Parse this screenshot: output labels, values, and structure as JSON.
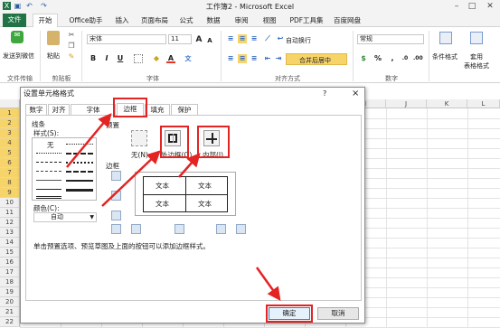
{
  "window": {
    "title": "工作簿2 - Microsoft Excel"
  },
  "ribbon_tabs": [
    "文件",
    "开始",
    "Office助手",
    "插入",
    "页面布局",
    "公式",
    "数据",
    "审阅",
    "视图",
    "PDF工具集",
    "百度网盘"
  ],
  "ribbon": {
    "send_wechat": "发送到微信",
    "paste": "粘贴",
    "font_name": "宋体",
    "font_size": "11",
    "wrap_text": "自动换行",
    "merge_center": "合并后居中",
    "number_format": "常规",
    "conditional_format": "条件格式",
    "table_format": "套用",
    "table_format2": "表格格式",
    "groups": {
      "file_transfer": "文件传输",
      "clipboard": "剪贴板",
      "font": "字体",
      "alignment": "对齐方式",
      "number": "数字"
    }
  },
  "columns": [
    "",
    "",
    "",
    "",
    "",
    "",
    "",
    "",
    "I",
    "J",
    "K",
    "L"
  ],
  "rows": [
    "1",
    "2",
    "3",
    "4",
    "5",
    "6",
    "7",
    "8",
    "9",
    "10",
    "11",
    "12",
    "13",
    "14",
    "15",
    "16",
    "17",
    "18",
    "19",
    "20",
    "21",
    "22"
  ],
  "dialog": {
    "title": "设置单元格格式",
    "help": "?",
    "close": "×",
    "tabs": [
      "数字",
      "对齐",
      "字体",
      "边框",
      "填充",
      "保护"
    ],
    "line_section": "线条",
    "style_label": "样式(S):",
    "none_style": "无",
    "color_label": "颜色(C):",
    "color_value": "自动",
    "presets_section": "预置",
    "preset_none": "无(N)",
    "preset_outline": "外边框(O)",
    "preset_inside": "内部(I)",
    "border_section": "边框",
    "preview_cells": [
      "文本",
      "文本",
      "文本",
      "文本"
    ],
    "hint": "单击预置选项、预览草图及上面的按钮可以添加边框样式。",
    "ok": "确定",
    "cancel": "取消"
  }
}
